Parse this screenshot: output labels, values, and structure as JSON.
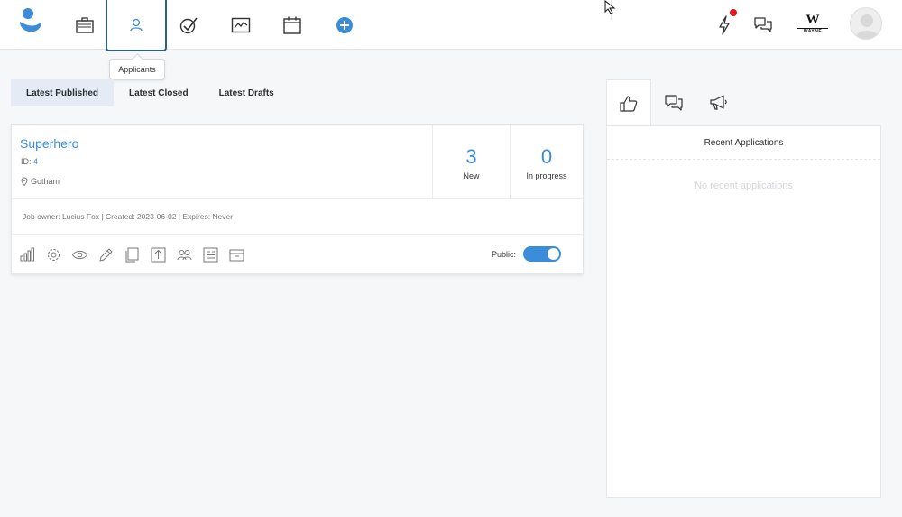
{
  "nav": {
    "items": [
      {
        "icon": "briefcase-icon"
      },
      {
        "icon": "applicants-icon",
        "active": true
      },
      {
        "icon": "check-circle-icon"
      },
      {
        "icon": "chart-icon"
      },
      {
        "icon": "calendar-icon"
      },
      {
        "icon": "plus-circle-icon"
      }
    ],
    "tooltip": "Applicants",
    "company_logo": {
      "mark": "W",
      "text": "WAYNE"
    }
  },
  "tabs": [
    {
      "label": "Latest Published",
      "active": true
    },
    {
      "label": "Latest Closed",
      "active": false
    },
    {
      "label": "Latest Drafts",
      "active": false
    }
  ],
  "job": {
    "title": "Superhero",
    "id_label": "ID:",
    "id_value": "4",
    "location": "Gotham",
    "stats": [
      {
        "value": "3",
        "label": "New"
      },
      {
        "value": "0",
        "label": "In progress"
      }
    ],
    "meta": "Job owner: Lucius Fox | Created: 2023-06-02 | Expires: Never",
    "public_label": "Public:",
    "public_on": true
  },
  "panel": {
    "title": "Recent Applications",
    "empty_text": "No recent applications"
  },
  "colors": {
    "accent": "#3b8cd9",
    "active_tab_bg": "#e4ebf5",
    "notification": "#e0161b"
  }
}
